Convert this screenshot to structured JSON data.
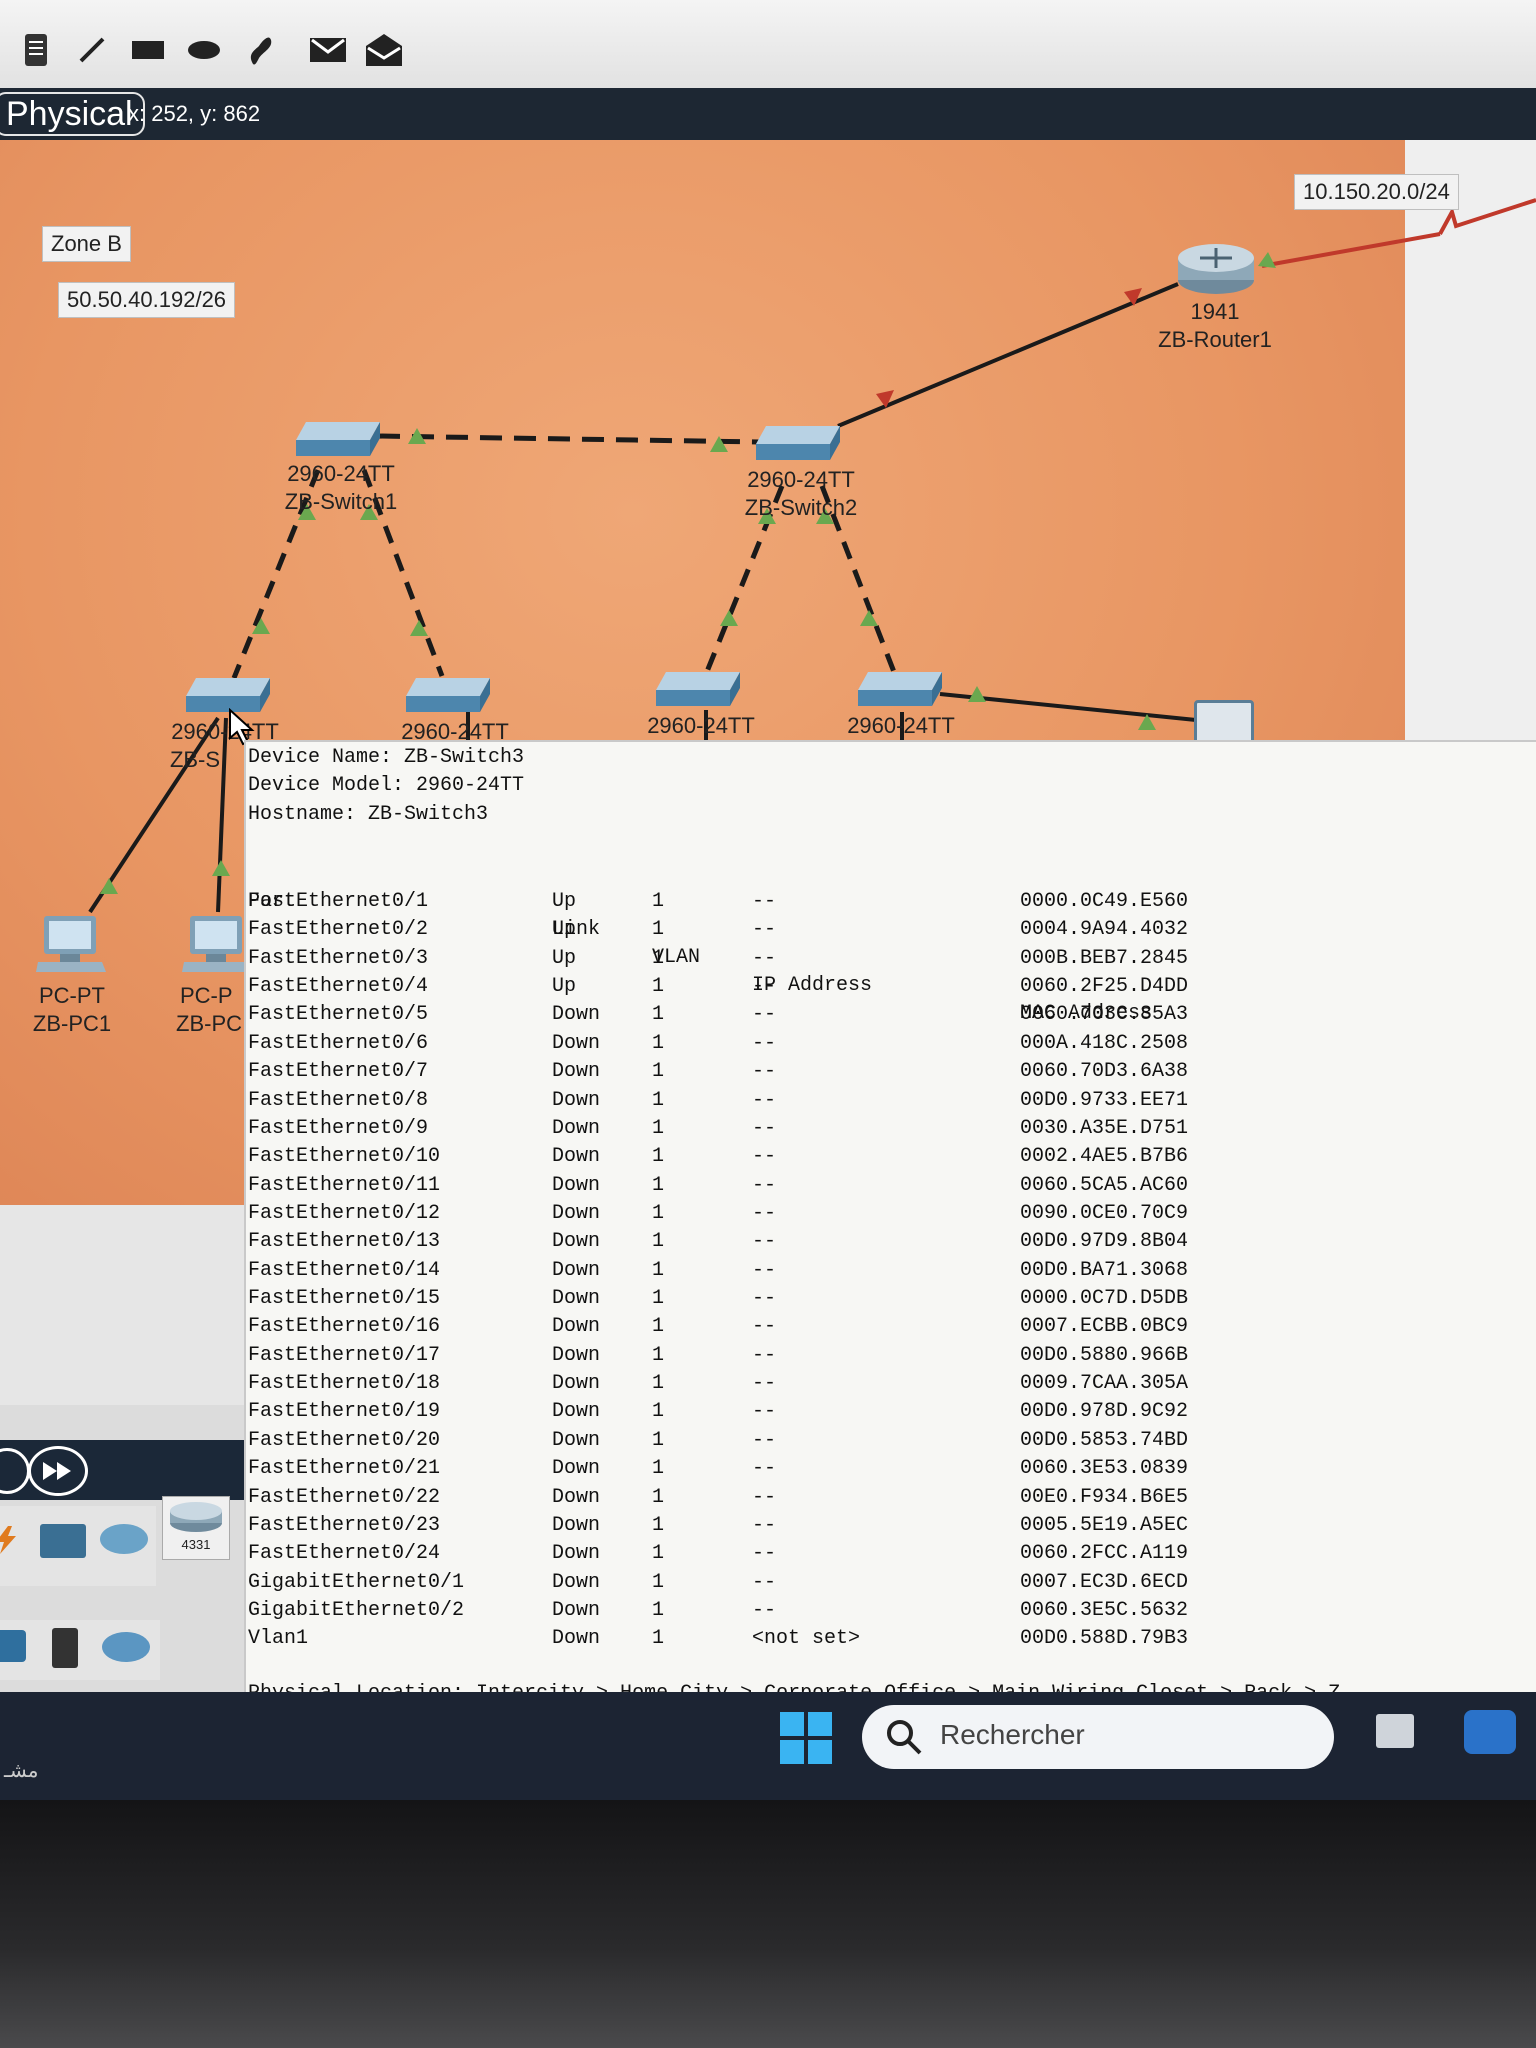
{
  "mode": {
    "label": "Physical",
    "coords": "x: 252, y: 862"
  },
  "canvas": {
    "zone_label": "Zone B",
    "subnet_label": "50.50.40.192/26",
    "wan_label": "10.150.20.0/24"
  },
  "devices": {
    "router": {
      "model": "1941",
      "name": "ZB-Router1"
    },
    "switch1": {
      "model": "2960-24TT",
      "name": "ZB-Switch1"
    },
    "switch2": {
      "model": "2960-24TT",
      "name": "ZB-Switch2"
    },
    "switch3": {
      "model": "2960-24TT",
      "name": "ZB-S"
    },
    "switch4": {
      "model": "2960-24TT"
    },
    "switch5": {
      "model": "2960-24TT"
    },
    "switch6": {
      "model": "2960-24TT"
    },
    "pc1": {
      "type": "PC-PT",
      "name": "ZB-PC1"
    },
    "pc2": {
      "type": "PC-P",
      "name": "ZB-PC"
    }
  },
  "palette": {
    "router_model": "4331"
  },
  "taskbar": {
    "search_placeholder": "Rechercher"
  },
  "tooltip": {
    "device_name": "Device Name: ZB-Switch3",
    "device_model": "Device Model: 2960-24TT",
    "hostname": "Hostname: ZB-Switch3",
    "headers": {
      "port": "Port",
      "link": "Link",
      "vlan": "VLAN",
      "ip": "IP Address",
      "mac": "MAC Address"
    },
    "rows": [
      {
        "port": "FastEthernet0/1",
        "link": "Up",
        "vlan": "1",
        "ip": "--",
        "mac": "0000.0C49.E560"
      },
      {
        "port": "FastEthernet0/2",
        "link": "Up",
        "vlan": "1",
        "ip": "--",
        "mac": "0004.9A94.4032"
      },
      {
        "port": "FastEthernet0/3",
        "link": "Up",
        "vlan": "1",
        "ip": "--",
        "mac": "000B.BEB7.2845"
      },
      {
        "port": "FastEthernet0/4",
        "link": "Up",
        "vlan": "1",
        "ip": "--",
        "mac": "0060.2F25.D4DD"
      },
      {
        "port": "FastEthernet0/5",
        "link": "Down",
        "vlan": "1",
        "ip": "--",
        "mac": "0060.703C.85A3"
      },
      {
        "port": "FastEthernet0/6",
        "link": "Down",
        "vlan": "1",
        "ip": "--",
        "mac": "000A.418C.2508"
      },
      {
        "port": "FastEthernet0/7",
        "link": "Down",
        "vlan": "1",
        "ip": "--",
        "mac": "0060.70D3.6A38"
      },
      {
        "port": "FastEthernet0/8",
        "link": "Down",
        "vlan": "1",
        "ip": "--",
        "mac": "00D0.9733.EE71"
      },
      {
        "port": "FastEthernet0/9",
        "link": "Down",
        "vlan": "1",
        "ip": "--",
        "mac": "0030.A35E.D751"
      },
      {
        "port": "FastEthernet0/10",
        "link": "Down",
        "vlan": "1",
        "ip": "--",
        "mac": "0002.4AE5.B7B6"
      },
      {
        "port": "FastEthernet0/11",
        "link": "Down",
        "vlan": "1",
        "ip": "--",
        "mac": "0060.5CA5.AC60"
      },
      {
        "port": "FastEthernet0/12",
        "link": "Down",
        "vlan": "1",
        "ip": "--",
        "mac": "0090.0CE0.70C9"
      },
      {
        "port": "FastEthernet0/13",
        "link": "Down",
        "vlan": "1",
        "ip": "--",
        "mac": "00D0.97D9.8B04"
      },
      {
        "port": "FastEthernet0/14",
        "link": "Down",
        "vlan": "1",
        "ip": "--",
        "mac": "00D0.BA71.3068"
      },
      {
        "port": "FastEthernet0/15",
        "link": "Down",
        "vlan": "1",
        "ip": "--",
        "mac": "0000.0C7D.D5DB"
      },
      {
        "port": "FastEthernet0/16",
        "link": "Down",
        "vlan": "1",
        "ip": "--",
        "mac": "0007.ECBB.0BC9"
      },
      {
        "port": "FastEthernet0/17",
        "link": "Down",
        "vlan": "1",
        "ip": "--",
        "mac": "00D0.5880.966B"
      },
      {
        "port": "FastEthernet0/18",
        "link": "Down",
        "vlan": "1",
        "ip": "--",
        "mac": "0009.7CAA.305A"
      },
      {
        "port": "FastEthernet0/19",
        "link": "Down",
        "vlan": "1",
        "ip": "--",
        "mac": "00D0.978D.9C92"
      },
      {
        "port": "FastEthernet0/20",
        "link": "Down",
        "vlan": "1",
        "ip": "--",
        "mac": "00D0.5853.74BD"
      },
      {
        "port": "FastEthernet0/21",
        "link": "Down",
        "vlan": "1",
        "ip": "--",
        "mac": "0060.3E53.0839"
      },
      {
        "port": "FastEthernet0/22",
        "link": "Down",
        "vlan": "1",
        "ip": "--",
        "mac": "00E0.F934.B6E5"
      },
      {
        "port": "FastEthernet0/23",
        "link": "Down",
        "vlan": "1",
        "ip": "--",
        "mac": "0005.5E19.A5EC"
      },
      {
        "port": "FastEthernet0/24",
        "link": "Down",
        "vlan": "1",
        "ip": "--",
        "mac": "0060.2FCC.A119"
      },
      {
        "port": "GigabitEthernet0/1",
        "link": "Down",
        "vlan": "1",
        "ip": "--",
        "mac": "0007.EC3D.6ECD"
      },
      {
        "port": "GigabitEthernet0/2",
        "link": "Down",
        "vlan": "1",
        "ip": "--",
        "mac": "0060.3E5C.5632"
      },
      {
        "port": "Vlan1",
        "link": "Down",
        "vlan": "1",
        "ip": "<not set>",
        "mac": "00D0.588D.79B3"
      }
    ],
    "physical_location": "Physical Location: Intercity > Home City > Corporate Office > Main Wiring Closet > Rack > Z"
  },
  "colors": {
    "canvas": "#e89663",
    "link_up": "#6aa84f",
    "link_down": "#c0392b",
    "modebar": "#1d2733"
  }
}
